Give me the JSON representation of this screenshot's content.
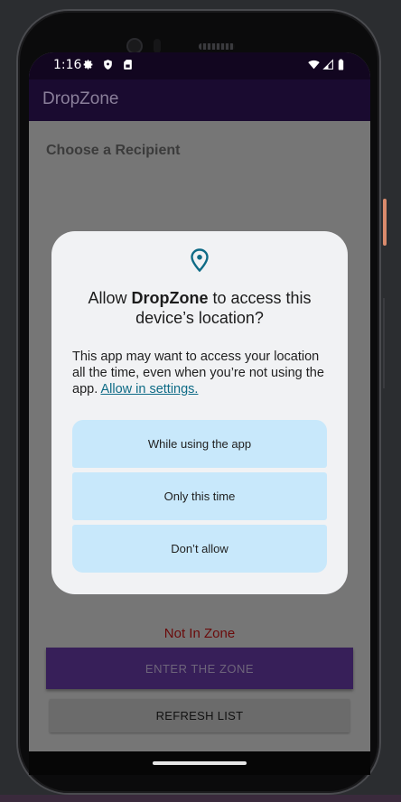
{
  "status": {
    "time": "1:16"
  },
  "app": {
    "title": "DropZone"
  },
  "content": {
    "section_title": "Choose a Recipient",
    "zone_status": "Not In Zone",
    "enter_button": "ENTER THE ZONE",
    "refresh_button": "REFRESH LIST"
  },
  "dialog": {
    "title_prefix": "Allow ",
    "title_app": "DropZone",
    "title_suffix": " to access this device’s location?",
    "body": "This app may want to access your location all the time, even when you’re not using the app. ",
    "link": "Allow in settings.",
    "options": [
      "While using the app",
      "Only this time",
      "Don’t allow"
    ]
  },
  "icons": {
    "settings": "gear-icon",
    "shield": "shield-icon",
    "sim": "sim-card-icon",
    "wifi": "wifi-icon",
    "signal": "signal-icon",
    "battery": "battery-icon",
    "location": "location-pin-icon"
  },
  "colors": {
    "accent": "#0e6b86",
    "option_bg": "#c8e8fb",
    "zone_status": "#6a0a0a",
    "enter_button_bg": "#371f59"
  }
}
